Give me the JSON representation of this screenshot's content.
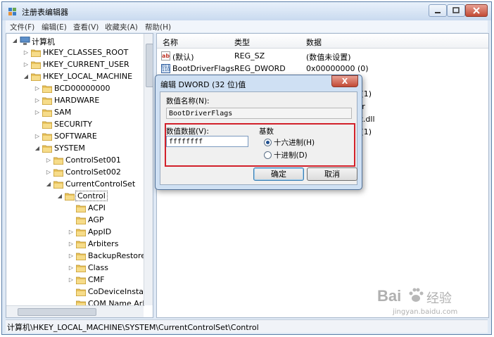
{
  "window": {
    "title": "注册表编辑器",
    "menu": [
      "文件(F)",
      "编辑(E)",
      "查看(V)",
      "收藏夹(A)",
      "帮助(H)"
    ]
  },
  "tree": {
    "root": "计算机",
    "items": [
      {
        "label": "HKEY_CLASSES_ROOT",
        "level": 1,
        "arrow": "right"
      },
      {
        "label": "HKEY_CURRENT_USER",
        "level": 1,
        "arrow": "right"
      },
      {
        "label": "HKEY_LOCAL_MACHINE",
        "level": 1,
        "arrow": "down"
      },
      {
        "label": "BCD00000000",
        "level": 2,
        "arrow": "right"
      },
      {
        "label": "HARDWARE",
        "level": 2,
        "arrow": "right"
      },
      {
        "label": "SAM",
        "level": 2,
        "arrow": "right"
      },
      {
        "label": "SECURITY",
        "level": 2,
        "arrow": "none"
      },
      {
        "label": "SOFTWARE",
        "level": 2,
        "arrow": "right"
      },
      {
        "label": "SYSTEM",
        "level": 2,
        "arrow": "down"
      },
      {
        "label": "ControlSet001",
        "level": 3,
        "arrow": "right"
      },
      {
        "label": "ControlSet002",
        "level": 3,
        "arrow": "right"
      },
      {
        "label": "CurrentControlSet",
        "level": 3,
        "arrow": "down"
      },
      {
        "label": "Control",
        "level": 4,
        "arrow": "down",
        "selected": true
      },
      {
        "label": "ACPI",
        "level": 5,
        "arrow": "none"
      },
      {
        "label": "AGP",
        "level": 5,
        "arrow": "none"
      },
      {
        "label": "AppID",
        "level": 5,
        "arrow": "right"
      },
      {
        "label": "Arbiters",
        "level": 5,
        "arrow": "right"
      },
      {
        "label": "BackupRestore",
        "level": 5,
        "arrow": "right"
      },
      {
        "label": "Class",
        "level": 5,
        "arrow": "right"
      },
      {
        "label": "CMF",
        "level": 5,
        "arrow": "right"
      },
      {
        "label": "CoDeviceInstall",
        "level": 5,
        "arrow": "none"
      },
      {
        "label": "COM Name Arl",
        "level": 5,
        "arrow": "none"
      }
    ]
  },
  "values": {
    "columns": [
      "名称",
      "类型",
      "数据"
    ],
    "rows": [
      {
        "name": "(默认)",
        "type": "REG_SZ",
        "data": "(数值未设置)",
        "icon": "string"
      },
      {
        "name": "BootDriverFlags",
        "type": "REG_DWORD",
        "data": "0x00000000 (0)",
        "icon": "binary"
      },
      {
        "name": "",
        "type": "",
        "data": "isk(0)partition(1)"
      },
      {
        "name": "",
        "type": "",
        "data": "trustedinstaller"
      },
      {
        "name": "",
        "type": "",
        "data": "ystem32\\scext.dll"
      },
      {
        "name": "",
        "type": "",
        "data": "isk(0)partition(1)"
      },
      {
        "name": "",
        "type": "",
        "data": "PTIN  PAE"
      }
    ]
  },
  "status": "计算机\\HKEY_LOCAL_MACHINE\\SYSTEM\\CurrentControlSet\\Control",
  "dialog": {
    "title": "编辑 DWORD (32 位)值",
    "name_label": "数值名称(N):",
    "name_value": "BootDriverFlags",
    "data_label": "数值数据(V):",
    "data_value": "ffffffff",
    "base_label": "基数",
    "hex_label": "十六进制(H)",
    "dec_label": "十进制(D)",
    "selected_base": "hex",
    "ok": "确定",
    "cancel": "取消",
    "close": "X"
  },
  "watermark": {
    "brand": "Bai",
    "site": "jingyan.baidu.com",
    "cn": "经验"
  },
  "colors": {
    "highlight": "#d2202a",
    "accent": "#3c7fb1"
  }
}
